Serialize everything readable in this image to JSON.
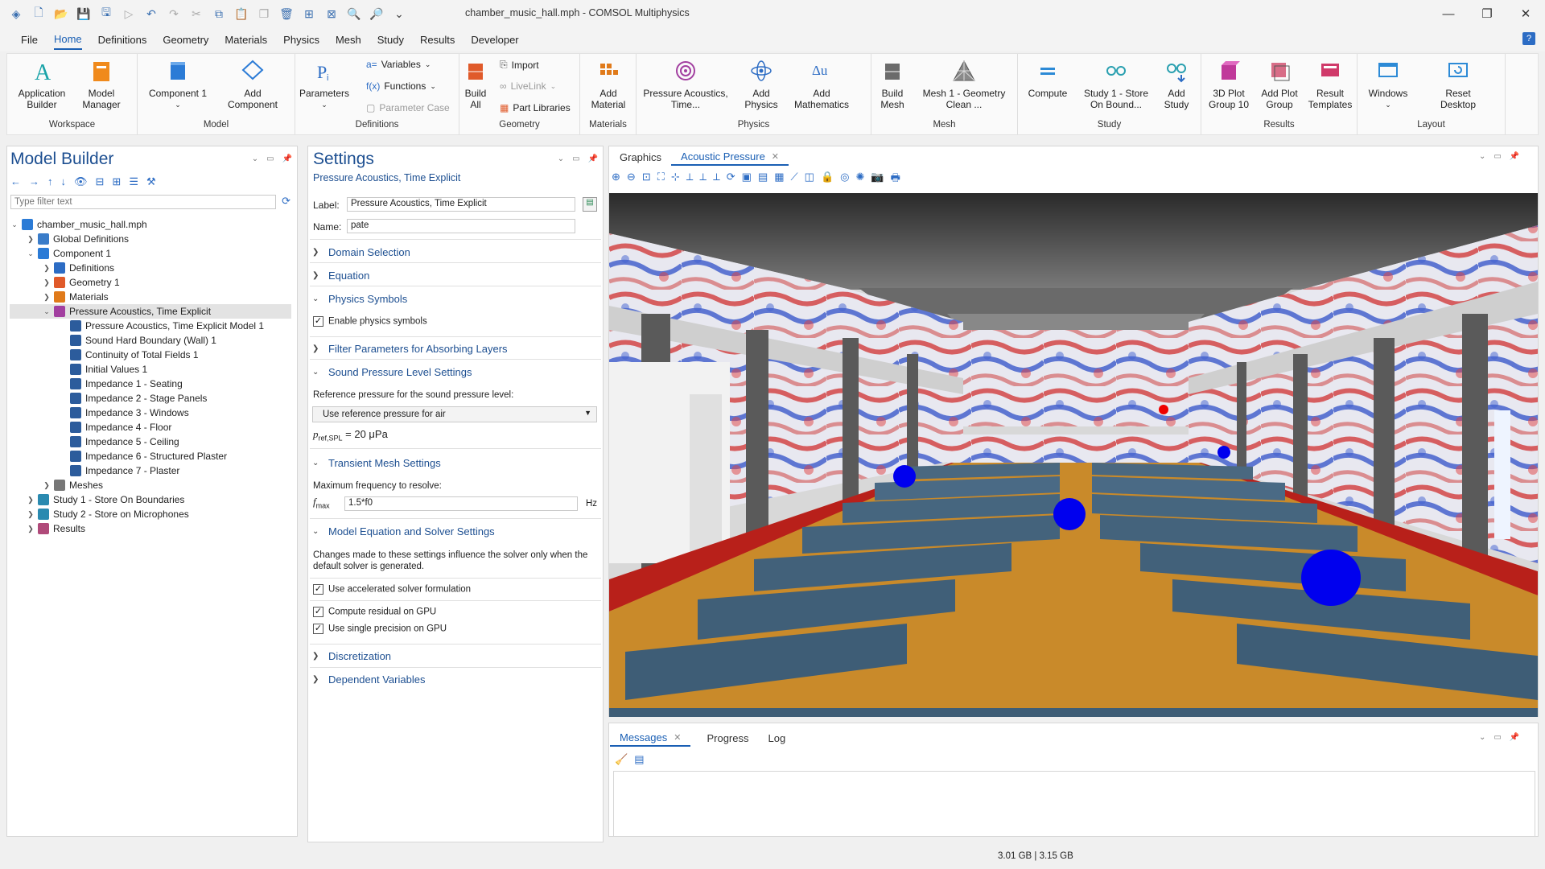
{
  "window": {
    "title": "chamber_music_hall.mph - COMSOL Multiphysics"
  },
  "menu": [
    "File",
    "Home",
    "Definitions",
    "Geometry",
    "Materials",
    "Physics",
    "Mesh",
    "Study",
    "Results",
    "Developer"
  ],
  "ribbon": {
    "workspace": {
      "group": "Workspace",
      "app_builder": "Application Builder",
      "model_manager": "Model Manager"
    },
    "model": {
      "group": "Model",
      "component": "Component 1",
      "add_component": "Add Component"
    },
    "definitions": {
      "group": "Definitions",
      "parameters": "Parameters",
      "variables": "Variables",
      "functions": "Functions",
      "parameter_case": "Parameter Case"
    },
    "geometry": {
      "group": "Geometry",
      "build_all": "Build All",
      "import": "Import",
      "livelink": "LiveLink",
      "part_libraries": "Part Libraries"
    },
    "materials": {
      "group": "Materials",
      "add_material": "Add Material"
    },
    "physics": {
      "group": "Physics",
      "pressure": "Pressure Acoustics, Time...",
      "add_physics": "Add Physics",
      "add_math": "Add Mathematics"
    },
    "mesh": {
      "group": "Mesh",
      "build_mesh": "Build Mesh",
      "mesh1": "Mesh 1 - Geometry Clean ..."
    },
    "study": {
      "group": "Study",
      "compute": "Compute",
      "study1": "Study 1 - Store On Bound...",
      "add_study": "Add Study"
    },
    "results": {
      "group": "Results",
      "plot3d": "3D Plot Group 10",
      "add_plot": "Add Plot Group",
      "templates": "Result Templates"
    },
    "layout": {
      "group": "Layout",
      "windows": "Windows",
      "reset": "Reset Desktop"
    }
  },
  "model_builder": {
    "title": "Model Builder",
    "filter_placeholder": "Type filter text",
    "tree": [
      {
        "label": "chamber_music_hall.mph",
        "level": 0,
        "exp": "v",
        "icon": "#2b7bd6"
      },
      {
        "label": "Global Definitions",
        "level": 1,
        "exp": ">",
        "icon": "#3a7cc9"
      },
      {
        "label": "Component 1",
        "level": 1,
        "exp": "v",
        "icon": "#2b7bd6"
      },
      {
        "label": "Definitions",
        "level": 2,
        "exp": ">",
        "icon": "#2c6cc4"
      },
      {
        "label": "Geometry 1",
        "level": 2,
        "exp": ">",
        "icon": "#e05a2a"
      },
      {
        "label": "Materials",
        "level": 2,
        "exp": ">",
        "icon": "#e07a1a"
      },
      {
        "label": "Pressure Acoustics, Time Explicit",
        "level": 2,
        "exp": "v",
        "icon": "#a23fa0",
        "sel": true
      },
      {
        "label": "Pressure Acoustics, Time Explicit Model 1",
        "level": 3,
        "exp": "",
        "icon": "#2c5c9c"
      },
      {
        "label": "Sound Hard Boundary (Wall) 1",
        "level": 3,
        "exp": "",
        "icon": "#2c5c9c"
      },
      {
        "label": "Continuity of Total Fields 1",
        "level": 3,
        "exp": "",
        "icon": "#2c5c9c"
      },
      {
        "label": "Initial Values 1",
        "level": 3,
        "exp": "",
        "icon": "#2c5c9c"
      },
      {
        "label": "Impedance 1 - Seating",
        "level": 3,
        "exp": "",
        "icon": "#2c5c9c"
      },
      {
        "label": "Impedance 2 - Stage Panels",
        "level": 3,
        "exp": "",
        "icon": "#2c5c9c"
      },
      {
        "label": "Impedance 3 - Windows",
        "level": 3,
        "exp": "",
        "icon": "#2c5c9c"
      },
      {
        "label": "Impedance 4 - Floor",
        "level": 3,
        "exp": "",
        "icon": "#2c5c9c"
      },
      {
        "label": "Impedance 5 - Ceiling",
        "level": 3,
        "exp": "",
        "icon": "#2c5c9c"
      },
      {
        "label": "Impedance 6 - Structured Plaster",
        "level": 3,
        "exp": "",
        "icon": "#2c5c9c"
      },
      {
        "label": "Impedance 7 - Plaster",
        "level": 3,
        "exp": "",
        "icon": "#2c5c9c"
      },
      {
        "label": "Meshes",
        "level": 2,
        "exp": ">",
        "icon": "#777777"
      },
      {
        "label": "Study 1 - Store On Boundaries",
        "level": 1,
        "exp": ">",
        "icon": "#2a8ab0"
      },
      {
        "label": "Study 2 - Store on Microphones",
        "level": 1,
        "exp": ">",
        "icon": "#2a8ab0"
      },
      {
        "label": "Results",
        "level": 1,
        "exp": ">",
        "icon": "#b04a7a"
      }
    ]
  },
  "settings": {
    "title": "Settings",
    "subtitle": "Pressure Acoustics, Time Explicit",
    "label_caption": "Label:",
    "label_value": "Pressure Acoustics, Time Explicit",
    "name_caption": "Name:",
    "name_value": "pate",
    "sections": {
      "domain": "Domain Selection",
      "equation": "Equation",
      "symbols": "Physics Symbols",
      "filter": "Filter Parameters for Absorbing Layers",
      "spl": "Sound Pressure Level Settings",
      "transient": "Transient Mesh Settings",
      "model_eq": "Model Equation and Solver Settings",
      "discretization": "Discretization",
      "dependent": "Dependent Variables"
    },
    "enable_symbols": "Enable physics symbols",
    "ref_pressure_caption": "Reference pressure for the sound pressure level:",
    "ref_pressure_option": "Use reference pressure for air",
    "pref_symbol": "p",
    "pref_sub": "ref,SPL",
    "pref_value": "= 20 μPa",
    "max_freq_caption": "Maximum frequency to resolve:",
    "fmax_symbol": "f",
    "fmax_sub": "max",
    "fmax_value": "1.5*f0",
    "fmax_unit": "Hz",
    "solver_note": "Changes made to these settings influence the solver only when the default solver is generated.",
    "accelerated": "Use accelerated solver formulation",
    "residual_gpu": "Compute residual on GPU",
    "single_precision": "Use single precision on GPU"
  },
  "graphics": {
    "tab1": "Graphics",
    "tab2": "Acoustic Pressure"
  },
  "messages": {
    "tab1": "Messages",
    "tab2": "Progress",
    "tab3": "Log"
  },
  "status": {
    "memory": "3.01 GB | 3.15 GB"
  }
}
